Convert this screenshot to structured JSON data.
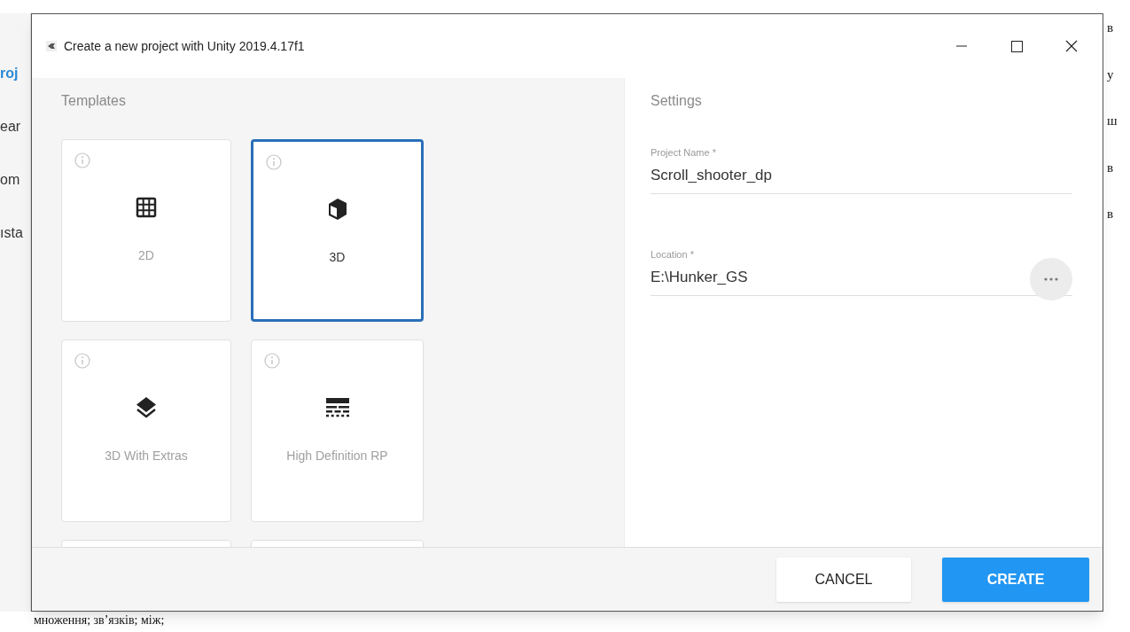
{
  "background_document": {
    "left_fragments": [
      {
        "text": "roj",
        "kind": "link"
      },
      {
        "text": "ear",
        "kind": "plain"
      },
      {
        "text": "om",
        "kind": "plain"
      },
      {
        "text": "ısta",
        "kind": "plain"
      }
    ],
    "right_fragments": [
      "в",
      "у",
      "ш",
      "в",
      "в"
    ],
    "bottom_line": "множення; зв’язків; між;"
  },
  "dialog": {
    "title": "Create a new project with Unity 2019.4.17f1",
    "templates_heading": "Templates",
    "templates": [
      {
        "label": "2D",
        "kind": "grid",
        "selected": false
      },
      {
        "label": "3D",
        "kind": "cube",
        "selected": true
      },
      {
        "label": "3D With Extras",
        "kind": "layers",
        "selected": false
      },
      {
        "label": "High Definition RP",
        "kind": "hdrp",
        "selected": false
      }
    ],
    "settings_heading": "Settings",
    "fields": [
      {
        "label": "Project Name *",
        "value": "Scroll_shooter_dp",
        "browse": false
      },
      {
        "label": "Location *",
        "value": "E:\\Hunker_GS",
        "browse": true
      }
    ],
    "buttons": [
      {
        "label": "CANCEL",
        "kind": "secondary"
      },
      {
        "label": "CREATE",
        "kind": "primary"
      }
    ]
  }
}
